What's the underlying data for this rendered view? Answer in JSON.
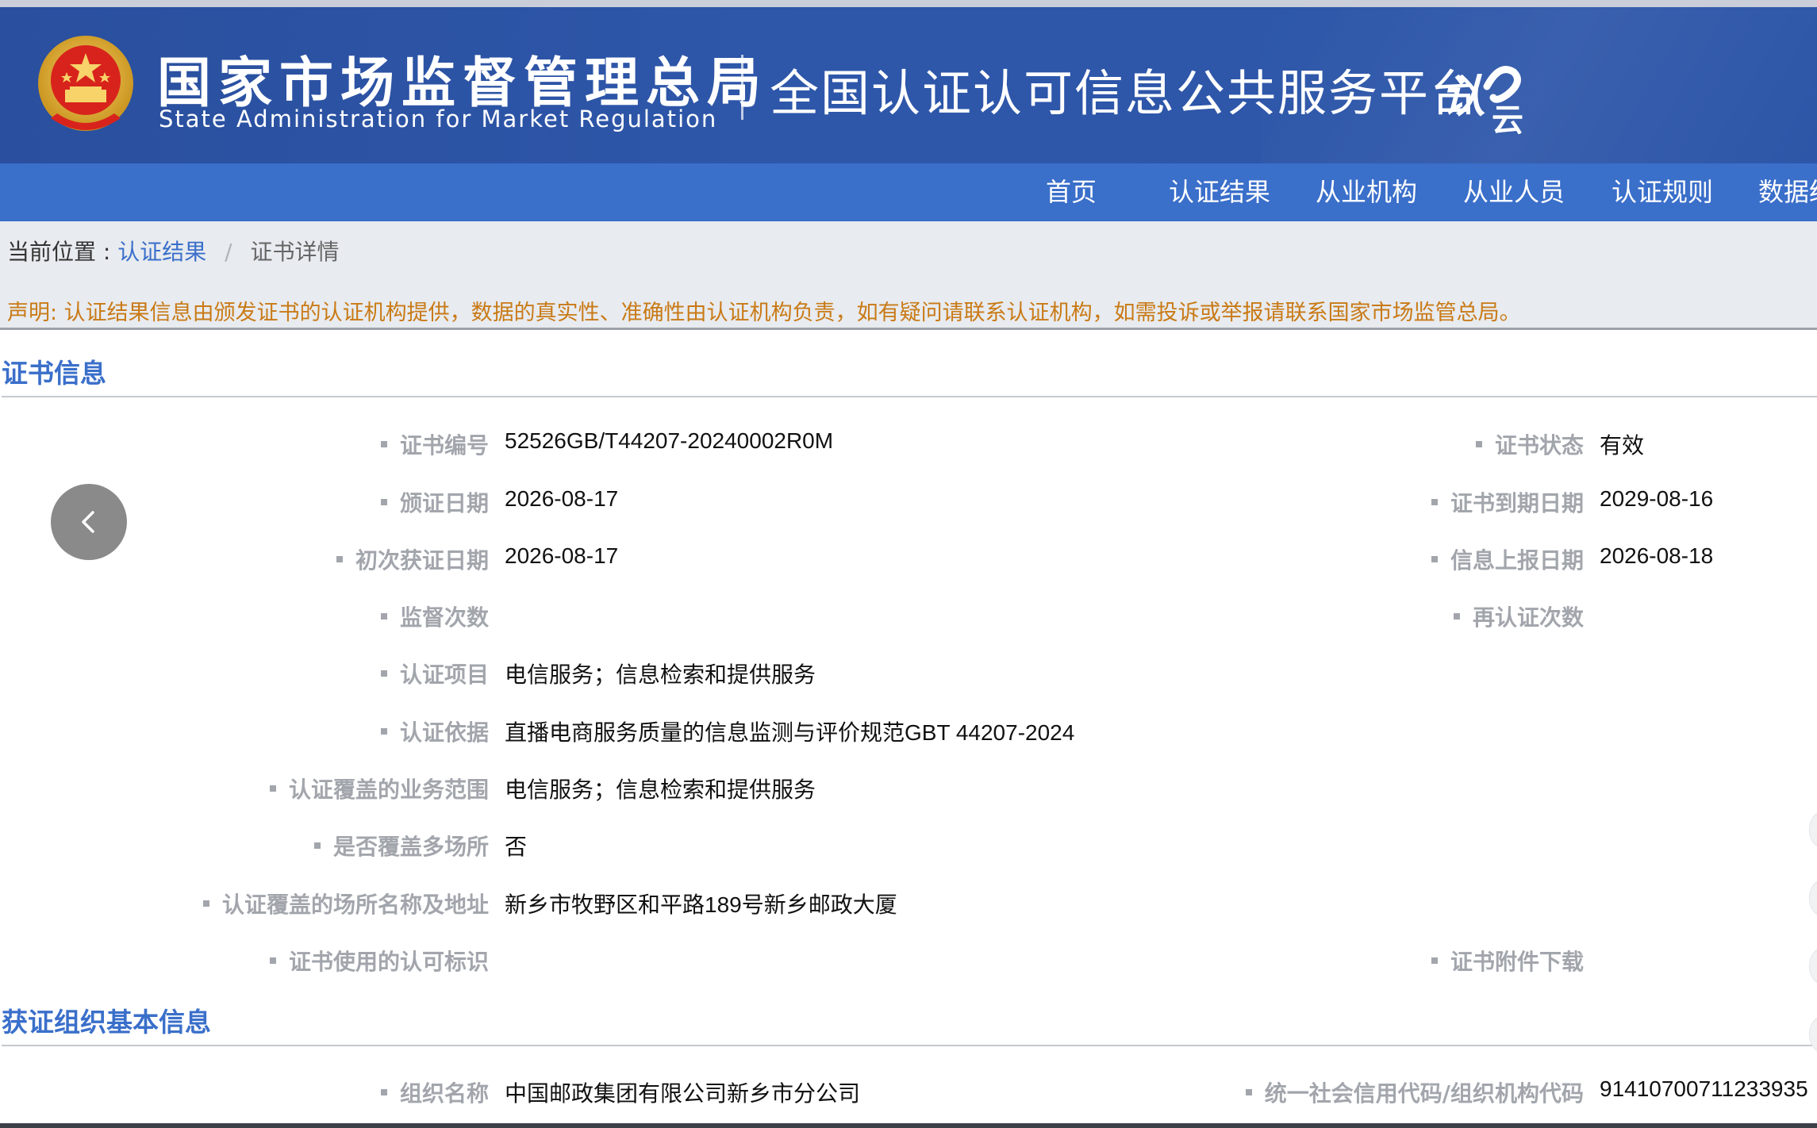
{
  "header": {
    "org_name_cn": "国家市场监督管理总局",
    "org_name_en": "State Administration  for  Market Regulation",
    "platform_title": "全国认证认可信息公共服务平台",
    "logo_text": "认云",
    "brand_color": "#2e57aa"
  },
  "nav": {
    "items": [
      {
        "label": "首页"
      },
      {
        "label": "认证结果"
      },
      {
        "label": "从业机构"
      },
      {
        "label": "从业人员"
      },
      {
        "label": "认证规则"
      },
      {
        "label": "数据统计"
      }
    ]
  },
  "breadcrumb": {
    "prefix": "当前位置 :",
    "link": "认证结果",
    "separator": "/",
    "current": "证书详情"
  },
  "notice": "声明: 认证结果信息由颁发证书的认证机构提供，数据的真实性、准确性由认证机构负责，如有疑问请联系认证机构，如需投诉或举报请联系国家市场监管总局。",
  "cert_section": {
    "title": "证书信息",
    "fields": {
      "cert_no": {
        "label": "证书编号",
        "value": "52526GB/T44207-20240002R0M"
      },
      "status": {
        "label": "证书状态",
        "value": "有效"
      },
      "issue_date": {
        "label": "颁证日期",
        "value": "2026-08-17"
      },
      "expire_date": {
        "label": "证书到期日期",
        "value": "2029-08-16"
      },
      "first_date": {
        "label": "初次获证日期",
        "value": "2026-08-17"
      },
      "report_date": {
        "label": "信息上报日期",
        "value": "2026-08-18"
      },
      "supervision": {
        "label": "监督次数",
        "value": ""
      },
      "recert": {
        "label": "再认证次数",
        "value": ""
      },
      "project": {
        "label": "认证项目",
        "value": "电信服务；信息检索和提供服务"
      },
      "basis": {
        "label": "认证依据",
        "value": "直播电商服务质量的信息监测与评价规范GBT 44207-2024"
      },
      "scope": {
        "label": "认证覆盖的业务范围",
        "value": "电信服务；信息检索和提供服务"
      },
      "multi_site": {
        "label": "是否覆盖多场所",
        "value": "否"
      },
      "site_address": {
        "label": "认证覆盖的场所名称及地址",
        "value": "新乡市牧野区和平路189号新乡邮政大厦"
      },
      "accred_mark": {
        "label": "证书使用的认可标识",
        "value": ""
      },
      "attachment": {
        "label": "证书附件下载",
        "value": ""
      }
    }
  },
  "org_section": {
    "title": "获证组织基本信息",
    "fields": {
      "org_name": {
        "label": "组织名称",
        "value": "中国邮政集团有限公司新乡市分公司"
      },
      "credit_code": {
        "label": "统一社会信用代码/组织机构代码",
        "value": "91410700711233935"
      }
    }
  }
}
